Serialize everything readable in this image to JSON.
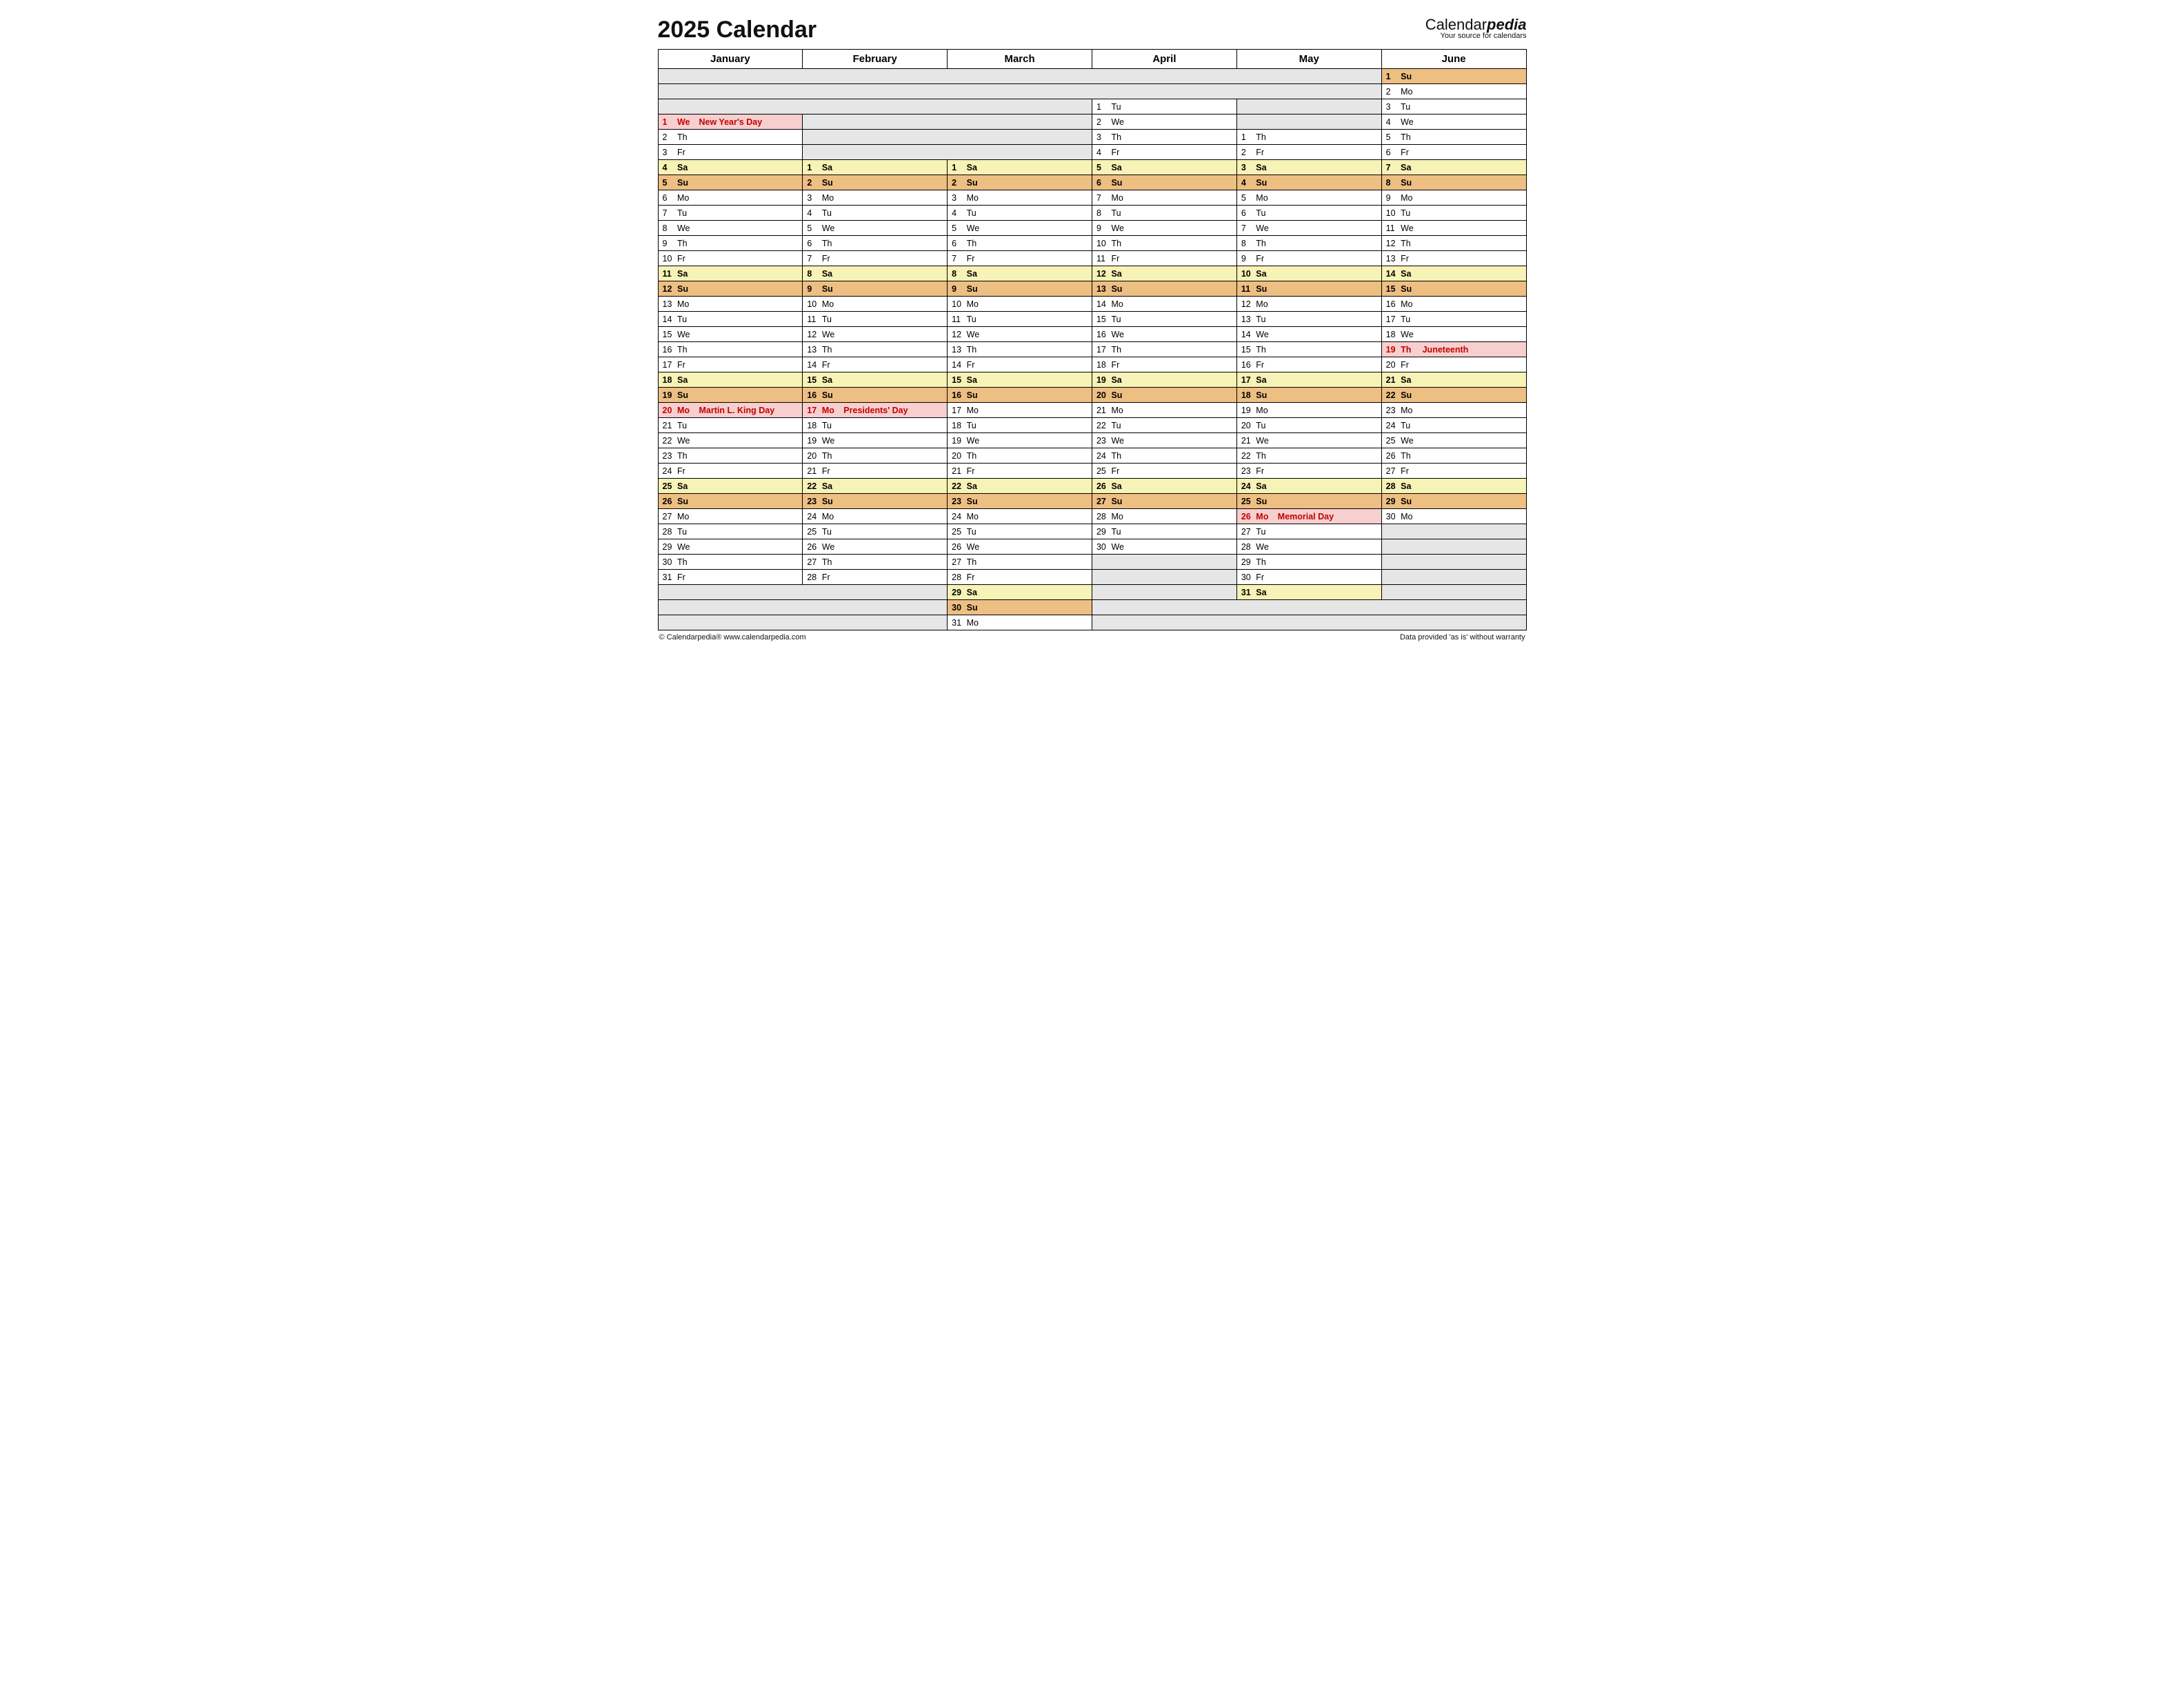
{
  "title": "2025 Calendar",
  "brand": {
    "main1": "Calendar",
    "main2": "pedia",
    "sub": "Your source for calendars"
  },
  "footer": {
    "left": "© Calendarpedia®   www.calendarpedia.com",
    "right": "Data provided 'as is' without warranty"
  },
  "dow": [
    "Su",
    "Mo",
    "Tu",
    "We",
    "Th",
    "Fr",
    "Sa"
  ],
  "rows": 37,
  "months": [
    {
      "name": "January",
      "offset": 3,
      "days": [
        {
          "n": 1,
          "w": 3,
          "h": "New Year's Day"
        },
        {
          "n": 2,
          "w": 4
        },
        {
          "n": 3,
          "w": 5
        },
        {
          "n": 4,
          "w": 6
        },
        {
          "n": 5,
          "w": 0
        },
        {
          "n": 6,
          "w": 1
        },
        {
          "n": 7,
          "w": 2
        },
        {
          "n": 8,
          "w": 3
        },
        {
          "n": 9,
          "w": 4
        },
        {
          "n": 10,
          "w": 5
        },
        {
          "n": 11,
          "w": 6
        },
        {
          "n": 12,
          "w": 0
        },
        {
          "n": 13,
          "w": 1
        },
        {
          "n": 14,
          "w": 2
        },
        {
          "n": 15,
          "w": 3
        },
        {
          "n": 16,
          "w": 4
        },
        {
          "n": 17,
          "w": 5
        },
        {
          "n": 18,
          "w": 6
        },
        {
          "n": 19,
          "w": 0
        },
        {
          "n": 20,
          "w": 1,
          "h": "Martin L. King Day"
        },
        {
          "n": 21,
          "w": 2
        },
        {
          "n": 22,
          "w": 3
        },
        {
          "n": 23,
          "w": 4
        },
        {
          "n": 24,
          "w": 5
        },
        {
          "n": 25,
          "w": 6
        },
        {
          "n": 26,
          "w": 0
        },
        {
          "n": 27,
          "w": 1
        },
        {
          "n": 28,
          "w": 2
        },
        {
          "n": 29,
          "w": 3
        },
        {
          "n": 30,
          "w": 4
        },
        {
          "n": 31,
          "w": 5
        }
      ]
    },
    {
      "name": "February",
      "offset": 6,
      "days": [
        {
          "n": 1,
          "w": 6
        },
        {
          "n": 2,
          "w": 0
        },
        {
          "n": 3,
          "w": 1
        },
        {
          "n": 4,
          "w": 2
        },
        {
          "n": 5,
          "w": 3
        },
        {
          "n": 6,
          "w": 4
        },
        {
          "n": 7,
          "w": 5
        },
        {
          "n": 8,
          "w": 6
        },
        {
          "n": 9,
          "w": 0
        },
        {
          "n": 10,
          "w": 1
        },
        {
          "n": 11,
          "w": 2
        },
        {
          "n": 12,
          "w": 3
        },
        {
          "n": 13,
          "w": 4
        },
        {
          "n": 14,
          "w": 5
        },
        {
          "n": 15,
          "w": 6
        },
        {
          "n": 16,
          "w": 0
        },
        {
          "n": 17,
          "w": 1,
          "h": "Presidents' Day"
        },
        {
          "n": 18,
          "w": 2
        },
        {
          "n": 19,
          "w": 3
        },
        {
          "n": 20,
          "w": 4
        },
        {
          "n": 21,
          "w": 5
        },
        {
          "n": 22,
          "w": 6
        },
        {
          "n": 23,
          "w": 0
        },
        {
          "n": 24,
          "w": 1
        },
        {
          "n": 25,
          "w": 2
        },
        {
          "n": 26,
          "w": 3
        },
        {
          "n": 27,
          "w": 4
        },
        {
          "n": 28,
          "w": 5
        }
      ]
    },
    {
      "name": "March",
      "offset": 6,
      "days": [
        {
          "n": 1,
          "w": 6
        },
        {
          "n": 2,
          "w": 0
        },
        {
          "n": 3,
          "w": 1
        },
        {
          "n": 4,
          "w": 2
        },
        {
          "n": 5,
          "w": 3
        },
        {
          "n": 6,
          "w": 4
        },
        {
          "n": 7,
          "w": 5
        },
        {
          "n": 8,
          "w": 6
        },
        {
          "n": 9,
          "w": 0
        },
        {
          "n": 10,
          "w": 1
        },
        {
          "n": 11,
          "w": 2
        },
        {
          "n": 12,
          "w": 3
        },
        {
          "n": 13,
          "w": 4
        },
        {
          "n": 14,
          "w": 5
        },
        {
          "n": 15,
          "w": 6
        },
        {
          "n": 16,
          "w": 0
        },
        {
          "n": 17,
          "w": 1
        },
        {
          "n": 18,
          "w": 2
        },
        {
          "n": 19,
          "w": 3
        },
        {
          "n": 20,
          "w": 4
        },
        {
          "n": 21,
          "w": 5
        },
        {
          "n": 22,
          "w": 6
        },
        {
          "n": 23,
          "w": 0
        },
        {
          "n": 24,
          "w": 1
        },
        {
          "n": 25,
          "w": 2
        },
        {
          "n": 26,
          "w": 3
        },
        {
          "n": 27,
          "w": 4
        },
        {
          "n": 28,
          "w": 5
        },
        {
          "n": 29,
          "w": 6
        },
        {
          "n": 30,
          "w": 0
        },
        {
          "n": 31,
          "w": 1
        }
      ]
    },
    {
      "name": "April",
      "offset": 2,
      "days": [
        {
          "n": 1,
          "w": 2
        },
        {
          "n": 2,
          "w": 3
        },
        {
          "n": 3,
          "w": 4
        },
        {
          "n": 4,
          "w": 5
        },
        {
          "n": 5,
          "w": 6
        },
        {
          "n": 6,
          "w": 0
        },
        {
          "n": 7,
          "w": 1
        },
        {
          "n": 8,
          "w": 2
        },
        {
          "n": 9,
          "w": 3
        },
        {
          "n": 10,
          "w": 4
        },
        {
          "n": 11,
          "w": 5
        },
        {
          "n": 12,
          "w": 6
        },
        {
          "n": 13,
          "w": 0
        },
        {
          "n": 14,
          "w": 1
        },
        {
          "n": 15,
          "w": 2
        },
        {
          "n": 16,
          "w": 3
        },
        {
          "n": 17,
          "w": 4
        },
        {
          "n": 18,
          "w": 5
        },
        {
          "n": 19,
          "w": 6
        },
        {
          "n": 20,
          "w": 0
        },
        {
          "n": 21,
          "w": 1
        },
        {
          "n": 22,
          "w": 2
        },
        {
          "n": 23,
          "w": 3
        },
        {
          "n": 24,
          "w": 4
        },
        {
          "n": 25,
          "w": 5
        },
        {
          "n": 26,
          "w": 6
        },
        {
          "n": 27,
          "w": 0
        },
        {
          "n": 28,
          "w": 1
        },
        {
          "n": 29,
          "w": 2
        },
        {
          "n": 30,
          "w": 3
        }
      ]
    },
    {
      "name": "May",
      "offset": 4,
      "days": [
        {
          "n": 1,
          "w": 4
        },
        {
          "n": 2,
          "w": 5
        },
        {
          "n": 3,
          "w": 6
        },
        {
          "n": 4,
          "w": 0
        },
        {
          "n": 5,
          "w": 1
        },
        {
          "n": 6,
          "w": 2
        },
        {
          "n": 7,
          "w": 3
        },
        {
          "n": 8,
          "w": 4
        },
        {
          "n": 9,
          "w": 5
        },
        {
          "n": 10,
          "w": 6
        },
        {
          "n": 11,
          "w": 0
        },
        {
          "n": 12,
          "w": 1
        },
        {
          "n": 13,
          "w": 2
        },
        {
          "n": 14,
          "w": 3
        },
        {
          "n": 15,
          "w": 4
        },
        {
          "n": 16,
          "w": 5
        },
        {
          "n": 17,
          "w": 6
        },
        {
          "n": 18,
          "w": 0
        },
        {
          "n": 19,
          "w": 1
        },
        {
          "n": 20,
          "w": 2
        },
        {
          "n": 21,
          "w": 3
        },
        {
          "n": 22,
          "w": 4
        },
        {
          "n": 23,
          "w": 5
        },
        {
          "n": 24,
          "w": 6
        },
        {
          "n": 25,
          "w": 0
        },
        {
          "n": 26,
          "w": 1,
          "h": "Memorial Day"
        },
        {
          "n": 27,
          "w": 2
        },
        {
          "n": 28,
          "w": 3
        },
        {
          "n": 29,
          "w": 4
        },
        {
          "n": 30,
          "w": 5
        },
        {
          "n": 31,
          "w": 6
        }
      ]
    },
    {
      "name": "June",
      "offset": 0,
      "days": [
        {
          "n": 1,
          "w": 0
        },
        {
          "n": 2,
          "w": 1
        },
        {
          "n": 3,
          "w": 2
        },
        {
          "n": 4,
          "w": 3
        },
        {
          "n": 5,
          "w": 4
        },
        {
          "n": 6,
          "w": 5
        },
        {
          "n": 7,
          "w": 6
        },
        {
          "n": 8,
          "w": 0
        },
        {
          "n": 9,
          "w": 1
        },
        {
          "n": 10,
          "w": 2
        },
        {
          "n": 11,
          "w": 3
        },
        {
          "n": 12,
          "w": 4
        },
        {
          "n": 13,
          "w": 5
        },
        {
          "n": 14,
          "w": 6
        },
        {
          "n": 15,
          "w": 0
        },
        {
          "n": 16,
          "w": 1
        },
        {
          "n": 17,
          "w": 2
        },
        {
          "n": 18,
          "w": 3
        },
        {
          "n": 19,
          "w": 4,
          "h": "Juneteenth"
        },
        {
          "n": 20,
          "w": 5
        },
        {
          "n": 21,
          "w": 6
        },
        {
          "n": 22,
          "w": 0
        },
        {
          "n": 23,
          "w": 1
        },
        {
          "n": 24,
          "w": 2
        },
        {
          "n": 25,
          "w": 3
        },
        {
          "n": 26,
          "w": 4
        },
        {
          "n": 27,
          "w": 5
        },
        {
          "n": 28,
          "w": 6
        },
        {
          "n": 29,
          "w": 0
        },
        {
          "n": 30,
          "w": 1
        }
      ]
    }
  ]
}
